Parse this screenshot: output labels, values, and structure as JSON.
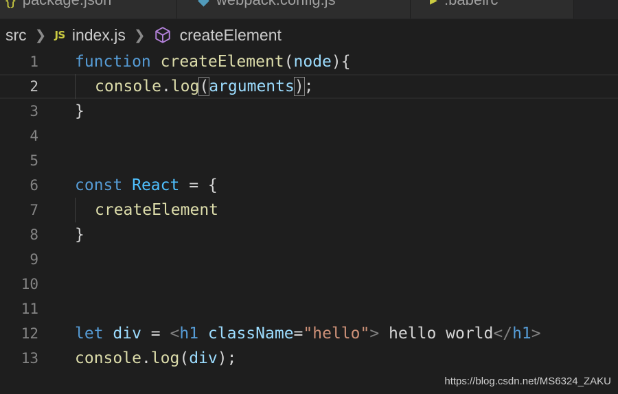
{
  "tabs": [
    {
      "label": "package.json",
      "icon": "braces-icon",
      "icon_glyph": "{}",
      "icon_color": "#cbcb41"
    },
    {
      "label": "webpack.config.js",
      "icon": "webpack-cube-icon",
      "icon_glyph": "◆",
      "icon_color": "#519aba"
    },
    {
      "label": ".babelrc",
      "icon": "babel-icon",
      "icon_glyph": "▸",
      "icon_color": "#cbcb41"
    }
  ],
  "breadcrumb": {
    "folder": "src",
    "file_icon": "JS",
    "file": "index.js",
    "symbol": "createElement"
  },
  "line_numbers": [
    "1",
    "2",
    "3",
    "4",
    "5",
    "6",
    "7",
    "8",
    "9",
    "10",
    "11",
    "12",
    "13"
  ],
  "code": {
    "l1": {
      "kw": "function",
      "name": "createElement",
      "open": "(",
      "param": "node",
      "close": "){"
    },
    "l2": {
      "obj": "console",
      "dot": ".",
      "method": "log",
      "open": "(",
      "arg": "arguments",
      "close": ")",
      "semi": ";"
    },
    "l3": {
      "text": "}"
    },
    "l6": {
      "kw": "const",
      "name": "React",
      "rest": " = {"
    },
    "l7": {
      "text": "createElement"
    },
    "l8": {
      "text": "}"
    },
    "l12": {
      "kw": "let",
      "var": "div",
      "eq": " = ",
      "lt": "<",
      "tag": "h1",
      "attr": "className",
      "eqs": "=",
      "str": "\"hello\"",
      "gt": ">",
      "text": " hello world",
      "closelt": "</",
      "closetag": "h1",
      "closegt": ">"
    },
    "l13": {
      "obj": "console",
      "dot": ".",
      "method": "log",
      "open": "(",
      "arg": "div",
      "close": ");"
    }
  },
  "colors": {
    "background": "#1e1e1e",
    "keyword": "#569cd6",
    "function": "#dcdcaa",
    "variable": "#9cdcfe",
    "constant": "#4fc1ff",
    "string": "#ce9178",
    "symbol_icon": "#b180d7"
  },
  "watermark": "https://blog.csdn.net/MS6324_ZAKU"
}
